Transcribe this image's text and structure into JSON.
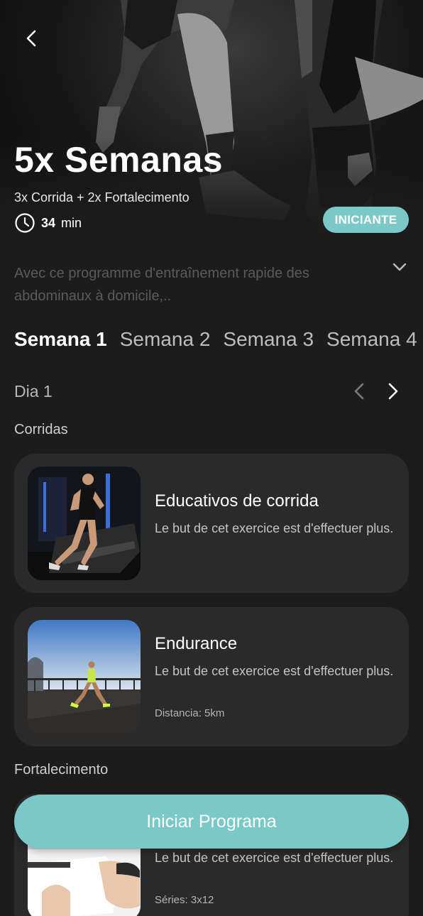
{
  "program": {
    "title": "5x Semanas",
    "subtitle": "3x Corrida + 2x Fortalecimento",
    "duration_value": "34",
    "duration_unit": "min",
    "level": "INICIANTE",
    "description": "Avec ce programme d'entraînement rapide des abdominaux à domicile,.."
  },
  "weeks": [
    "Semana 1",
    "Semana 2",
    "Semana 3",
    "Semana 4"
  ],
  "day": {
    "label": "Dia 1"
  },
  "sections": {
    "running": "Corridas",
    "strength": "Fortalecimento"
  },
  "exercises": [
    {
      "title": "Educativos de corrida",
      "description": "Le but de cet exercice est d'effectuer plus.",
      "meta": ""
    },
    {
      "title": "Endurance",
      "description": "Le but de cet exercice est d'effectuer plus.",
      "meta": "Distancia: 5km"
    },
    {
      "title": "",
      "description": "Le but de cet exercice est d'effectuer plus.",
      "meta": "Séries: 3x12"
    }
  ],
  "cta": {
    "label": "Iniciar Programa"
  },
  "colors": {
    "accent": "#7bc8c8",
    "background": "#1c1c1c",
    "card": "#2a2a2a"
  },
  "icons": {
    "back": "chevron-left-icon",
    "clock": "clock-icon",
    "expand": "chevron-down-icon",
    "prev_day": "chevron-left-icon",
    "next_day": "chevron-right-icon"
  }
}
